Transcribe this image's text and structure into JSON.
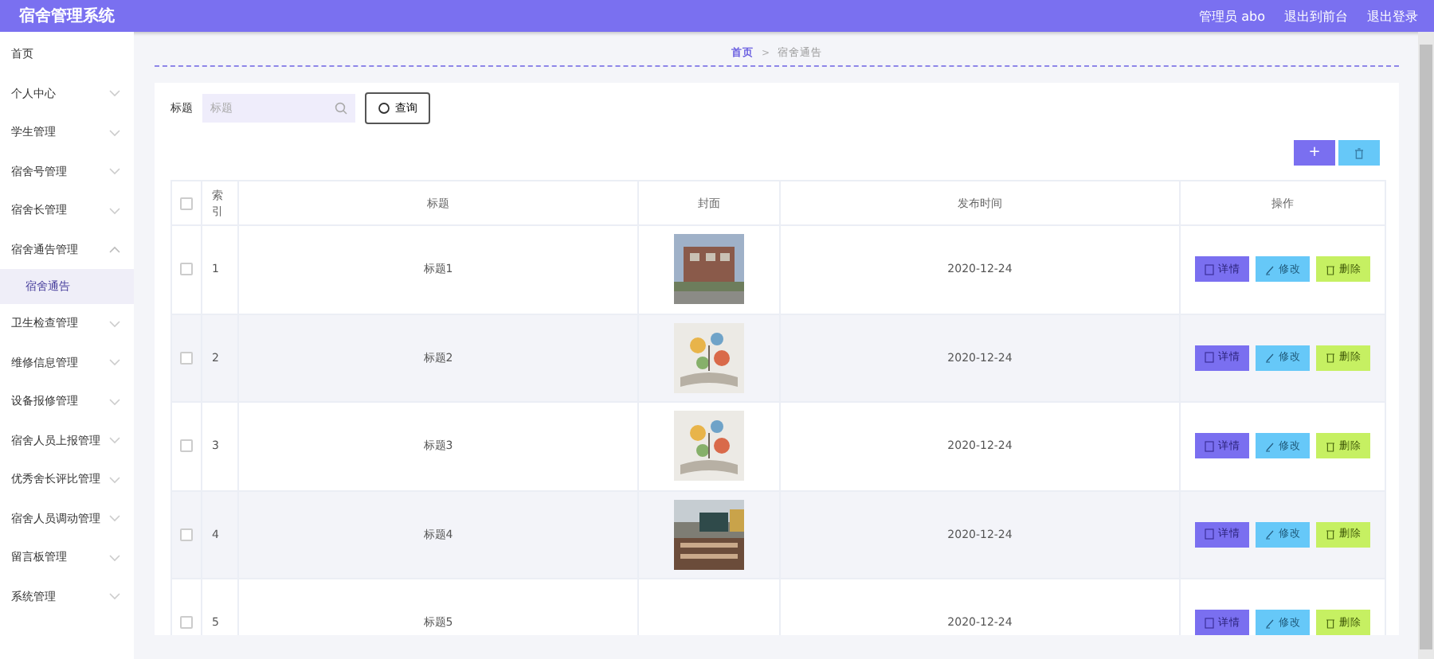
{
  "header": {
    "title": "宿舍管理系统",
    "links": [
      "管理员 abo",
      "退出到前台",
      "退出登录"
    ]
  },
  "sidebar": {
    "items": [
      {
        "label": "首页",
        "expandable": false,
        "expanded": false
      },
      {
        "label": "个人中心",
        "expandable": true,
        "expanded": false
      },
      {
        "label": "学生管理",
        "expandable": true,
        "expanded": false
      },
      {
        "label": "宿舍号管理",
        "expandable": true,
        "expanded": false
      },
      {
        "label": "宿舍长管理",
        "expandable": true,
        "expanded": false
      },
      {
        "label": "宿舍通告管理",
        "expandable": true,
        "expanded": true,
        "children": [
          {
            "label": "宿舍通告",
            "selected": true
          }
        ]
      },
      {
        "label": "卫生检查管理",
        "expandable": true,
        "expanded": false
      },
      {
        "label": "维修信息管理",
        "expandable": true,
        "expanded": false
      },
      {
        "label": "设备报修管理",
        "expandable": true,
        "expanded": false
      },
      {
        "label": "宿舍人员上报管理",
        "expandable": true,
        "expanded": false
      },
      {
        "label": "优秀舍长评比管理",
        "expandable": true,
        "expanded": false
      },
      {
        "label": "宿舍人员调动管理",
        "expandable": true,
        "expanded": false
      },
      {
        "label": "留言板管理",
        "expandable": true,
        "expanded": false
      },
      {
        "label": "系统管理",
        "expandable": true,
        "expanded": false
      }
    ]
  },
  "breadcrumb": {
    "items": [
      "首页",
      "宿舍通告"
    ],
    "separator": ">"
  },
  "search": {
    "label": "标题",
    "placeholder": "标题",
    "button": "查询"
  },
  "toolbar": {
    "add": "+"
  },
  "table": {
    "header_checked": false,
    "columns": [
      "索引",
      "标题",
      "封面",
      "发布时间",
      "操作"
    ],
    "rows": [
      {
        "checked": false,
        "index": "1",
        "title": "标题1",
        "date": "2020-12-24",
        "actions": [
          "详情",
          "修改",
          "删除"
        ]
      },
      {
        "checked": false,
        "index": "2",
        "title": "标题2",
        "date": "2020-12-24",
        "actions": [
          "详情",
          "修改",
          "删除"
        ]
      },
      {
        "checked": false,
        "index": "3",
        "title": "标题3",
        "date": "2020-12-24",
        "actions": [
          "详情",
          "修改",
          "删除"
        ]
      },
      {
        "checked": false,
        "index": "4",
        "title": "标题4",
        "date": "2020-12-24",
        "actions": [
          "详情",
          "修改",
          "删除"
        ]
      },
      {
        "checked": false,
        "index": "5",
        "title": "标题5",
        "date": "2020-12-24",
        "actions": [
          "详情",
          "修改",
          "删除"
        ]
      }
    ]
  }
}
